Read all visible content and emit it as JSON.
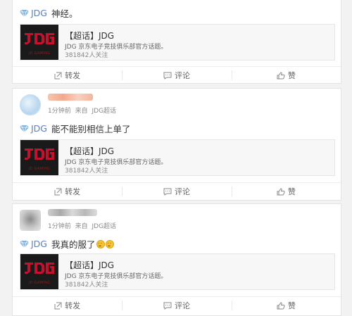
{
  "topic_card": {
    "title": "【超话】JDG",
    "desc": "JDG 京东电子竞技俱乐部官方话题。",
    "count": "381842人关注",
    "logo_text": "JD GAMING"
  },
  "actions": {
    "repost": "转发",
    "comment": "评论",
    "like": "赞"
  },
  "posts": [
    {
      "topic": "JDG",
      "text": "神经。"
    },
    {
      "time": "1分钟前",
      "from": "来自",
      "source": "JDG超话",
      "topic": "JDG",
      "text": "能不能别相信上单了"
    },
    {
      "time": "1分钟前",
      "from": "来自",
      "source": "JDG超话",
      "topic": "JDG",
      "text": "我真的服了"
    }
  ],
  "colors": {
    "link": "#5a7fb8",
    "logo_red": "#c8102e",
    "bg": "#f2f2f2"
  }
}
